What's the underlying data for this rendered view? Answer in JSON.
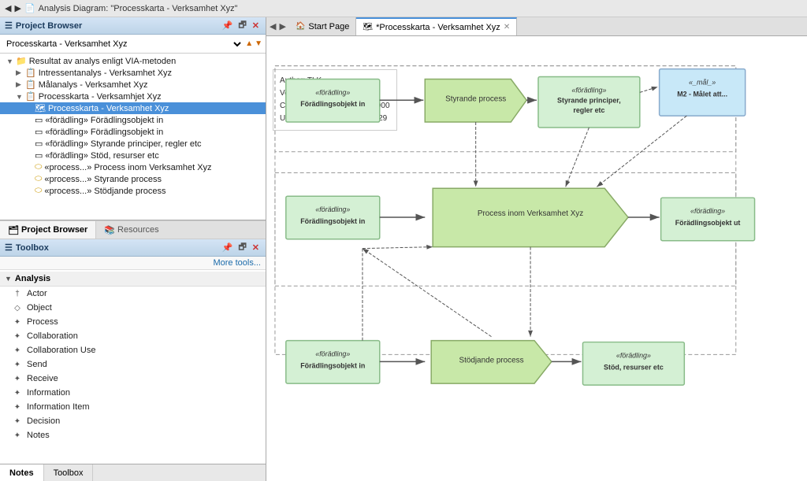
{
  "topBar": {
    "breadcrumb": "Analysis Diagram: \"Processkarta - Verksamhet Xyz\""
  },
  "projectBrowser": {
    "title": "Project Browser",
    "selector": "Processkarta - Verksamhet Xyz",
    "items": [
      {
        "id": "root",
        "indent": 1,
        "arrow": "▼",
        "icon": "📁",
        "label": "Resultat av analys enligt VIA-metoden",
        "type": "folder"
      },
      {
        "id": "int",
        "indent": 2,
        "arrow": "▶",
        "icon": "📄",
        "label": "Intressentanalys - Verksamhet Xyz",
        "type": "doc"
      },
      {
        "id": "mal",
        "indent": 2,
        "arrow": "▶",
        "icon": "📄",
        "label": "Målanalys - Verksamhet Xyz",
        "type": "doc"
      },
      {
        "id": "proc",
        "indent": 2,
        "arrow": "▼",
        "icon": "📄",
        "label": "Processkarta - Verksamhjet Xyz",
        "type": "doc"
      },
      {
        "id": "pk",
        "indent": 3,
        "arrow": "",
        "icon": "🗺",
        "label": "Processkarta - Verksamhet Xyz",
        "type": "diagram",
        "selected": true
      },
      {
        "id": "f1",
        "indent": 3,
        "arrow": "",
        "icon": "▭",
        "label": "«förädling» Förädlingsobjekt in",
        "type": "shape"
      },
      {
        "id": "f2",
        "indent": 3,
        "arrow": "",
        "icon": "▭",
        "label": "«förädling» Förädlingsobjekt in",
        "type": "shape"
      },
      {
        "id": "f3",
        "indent": 3,
        "arrow": "",
        "icon": "▭",
        "label": "«förädling» Styrande principer, regler etc",
        "type": "shape"
      },
      {
        "id": "f4",
        "indent": 3,
        "arrow": "",
        "icon": "▭",
        "label": "«förädling» Stöd, resurser etc",
        "type": "shape"
      },
      {
        "id": "p1",
        "indent": 3,
        "arrow": "",
        "icon": "🟡",
        "label": "«process...» Process inom Verksamhet Xyz",
        "type": "process"
      },
      {
        "id": "p2",
        "indent": 3,
        "arrow": "",
        "icon": "🟡",
        "label": "«process...» Styrande process",
        "type": "process"
      },
      {
        "id": "p3",
        "indent": 3,
        "arrow": "",
        "icon": "🟡",
        "label": "«process...» Stödjande process",
        "type": "process"
      }
    ],
    "tabs": [
      {
        "id": "project-browser",
        "label": "Project Browser",
        "active": true,
        "icon": "🗂"
      },
      {
        "id": "resources",
        "label": "Resources",
        "active": false,
        "icon": "📚"
      }
    ]
  },
  "toolbox": {
    "title": "Toolbox",
    "moreTools": "More tools...",
    "section": {
      "label": "Analysis",
      "items": [
        {
          "id": "actor",
          "label": "Actor",
          "icon": "†"
        },
        {
          "id": "object",
          "label": "Object",
          "icon": "◇"
        },
        {
          "id": "process",
          "label": "Process",
          "icon": "✦"
        },
        {
          "id": "collaboration",
          "label": "Collaboration",
          "icon": "✦"
        },
        {
          "id": "collaboration-use",
          "label": "Collaboration Use",
          "icon": "✦"
        },
        {
          "id": "send",
          "label": "Send",
          "icon": "✦"
        },
        {
          "id": "receive",
          "label": "Receive",
          "icon": "✦"
        },
        {
          "id": "information",
          "label": "Information",
          "icon": "✦"
        },
        {
          "id": "information-item",
          "label": "Information Item",
          "icon": "✦"
        },
        {
          "id": "decision",
          "label": "Decision",
          "icon": "✦"
        },
        {
          "id": "notes",
          "label": "Notes",
          "icon": "✦"
        }
      ]
    }
  },
  "bottomTabs": [
    {
      "id": "notes",
      "label": "Notes",
      "active": true
    },
    {
      "id": "toolbox",
      "label": "Toolbox",
      "active": false
    }
  ],
  "diagram": {
    "tabs": [
      {
        "id": "start-page",
        "label": "Start Page",
        "active": false,
        "icon": "🏠",
        "closable": false
      },
      {
        "id": "processkarta",
        "label": "*Processkarta - Verksamhet Xyz",
        "active": true,
        "icon": "🗺",
        "closable": true
      }
    ],
    "infoBox": {
      "author": "Author: TLK",
      "version": "Version: 0.1",
      "created": "Created: 2018-01-08 00:00:000",
      "updated": "Updated: 2018-01-08 14:21:29"
    }
  }
}
